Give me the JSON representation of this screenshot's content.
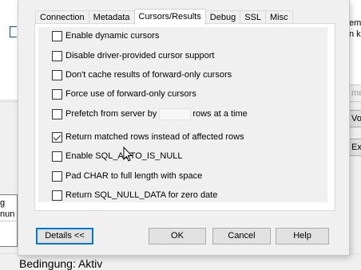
{
  "background": {
    "right_text": [
      "em",
      "n k"
    ],
    "right_buttons": [
      "me",
      "Vor",
      "Exp"
    ],
    "left_texts": [
      "g",
      "nun"
    ],
    "bottom_text": "Bedingung: Aktiv"
  },
  "dialog": {
    "tabs": [
      {
        "label": "Connection",
        "active": false
      },
      {
        "label": "Metadata",
        "active": false
      },
      {
        "label": "Cursors/Results",
        "active": true
      },
      {
        "label": "Debug",
        "active": false
      },
      {
        "label": "SSL",
        "active": false
      },
      {
        "label": "Misc",
        "active": false
      }
    ],
    "options": [
      {
        "label": "Enable dynamic cursors",
        "checked": false
      },
      {
        "label": "Disable driver-provided cursor support",
        "checked": false
      },
      {
        "label": "Don't cache results of forward-only cursors",
        "checked": false
      },
      {
        "label": "Force use of forward-only cursors",
        "checked": false
      },
      {
        "label": "Prefetch from server by",
        "suffix": "rows at a time",
        "value": "",
        "checked": false
      },
      {
        "label": "Return matched rows instead of affected rows",
        "checked": true
      },
      {
        "label": "Enable SQL_AUTO_IS_NULL",
        "checked": false
      },
      {
        "label": "Pad CHAR to full length with space",
        "checked": false
      },
      {
        "label": "Return SQL_NULL_DATA for zero date",
        "checked": false
      }
    ],
    "buttons": {
      "details": "Details <<",
      "ok": "OK",
      "cancel": "Cancel",
      "help": "Help"
    }
  }
}
